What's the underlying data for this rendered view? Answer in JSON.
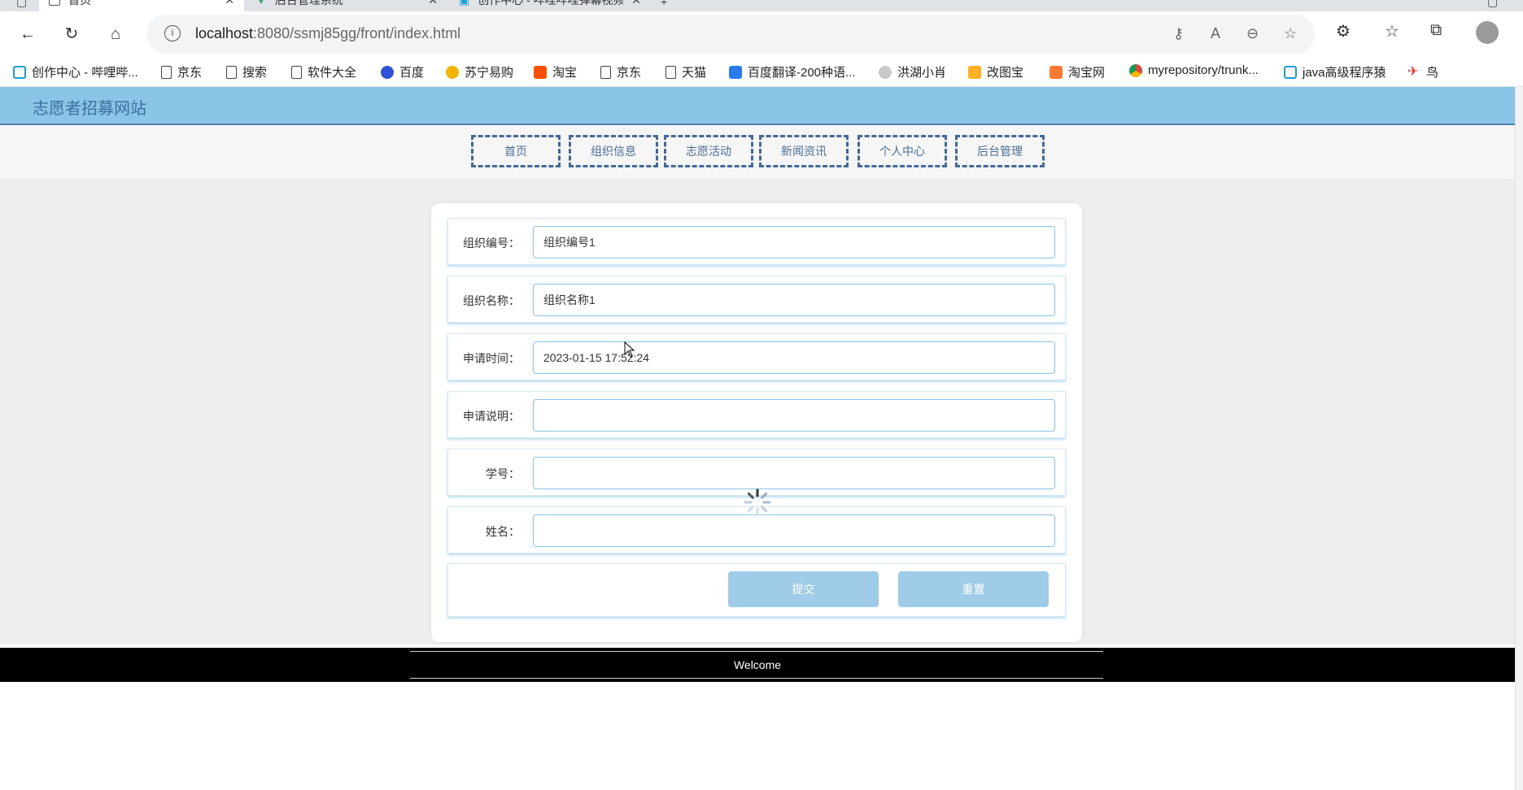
{
  "browser": {
    "tabs": [
      {
        "title": "首页",
        "active": true
      },
      {
        "title": "后台管理系统",
        "active": false
      },
      {
        "title": "创作中心 - 哔哩哔哩弹幕视频网",
        "active": false
      }
    ],
    "address": {
      "host": "localhost",
      "rest": ":8080/ssmj85gg/front/index.html"
    },
    "bookmarks": [
      {
        "label": "创作中心 - 哔哩哔...",
        "icon": "bilibili-icon"
      },
      {
        "label": "京东",
        "icon": "document-icon"
      },
      {
        "label": "搜索",
        "icon": "document-icon"
      },
      {
        "label": "软件大全",
        "icon": "document-icon"
      },
      {
        "label": "百度",
        "icon": "baidu-icon"
      },
      {
        "label": "苏宁易购",
        "icon": "suning-icon"
      },
      {
        "label": "淘宝",
        "icon": "taobao-icon"
      },
      {
        "label": "京东",
        "icon": "document-icon"
      },
      {
        "label": "天猫",
        "icon": "document-icon"
      },
      {
        "label": "百度翻译-200种语...",
        "icon": "baidu-translate-icon"
      },
      {
        "label": "洪湖小肖",
        "icon": "bird-icon"
      },
      {
        "label": "改图宝",
        "icon": "gaitubao-icon"
      },
      {
        "label": "淘宝网",
        "icon": "taobao-icon"
      },
      {
        "label": "myrepository/trunk...",
        "icon": "chrome-icon"
      },
      {
        "label": "java高级程序猿",
        "icon": "bilibili-icon"
      },
      {
        "label": "鸟",
        "icon": "bird-icon"
      }
    ]
  },
  "site": {
    "title": "志愿者招募网站",
    "nav": [
      "首页",
      "组织信息",
      "志愿活动",
      "新闻资讯",
      "个人中心",
      "后台管理"
    ]
  },
  "form": {
    "fields": [
      {
        "label": "组织编号：",
        "value": "组织编号1"
      },
      {
        "label": "组织名称：",
        "value": "组织名称1"
      },
      {
        "label": "申请时间：",
        "value": "2023-01-15 17:52:24"
      },
      {
        "label": "申请说明：",
        "value": ""
      },
      {
        "label": "学号：",
        "value": ""
      },
      {
        "label": "姓名：",
        "value": ""
      }
    ],
    "submit_label": "提交",
    "reset_label": "重置"
  },
  "footer": {
    "text": "Welcome"
  },
  "colors": {
    "header": "#8ac4e6",
    "accent": "#3f6a9b",
    "button": "#9fcce8"
  }
}
